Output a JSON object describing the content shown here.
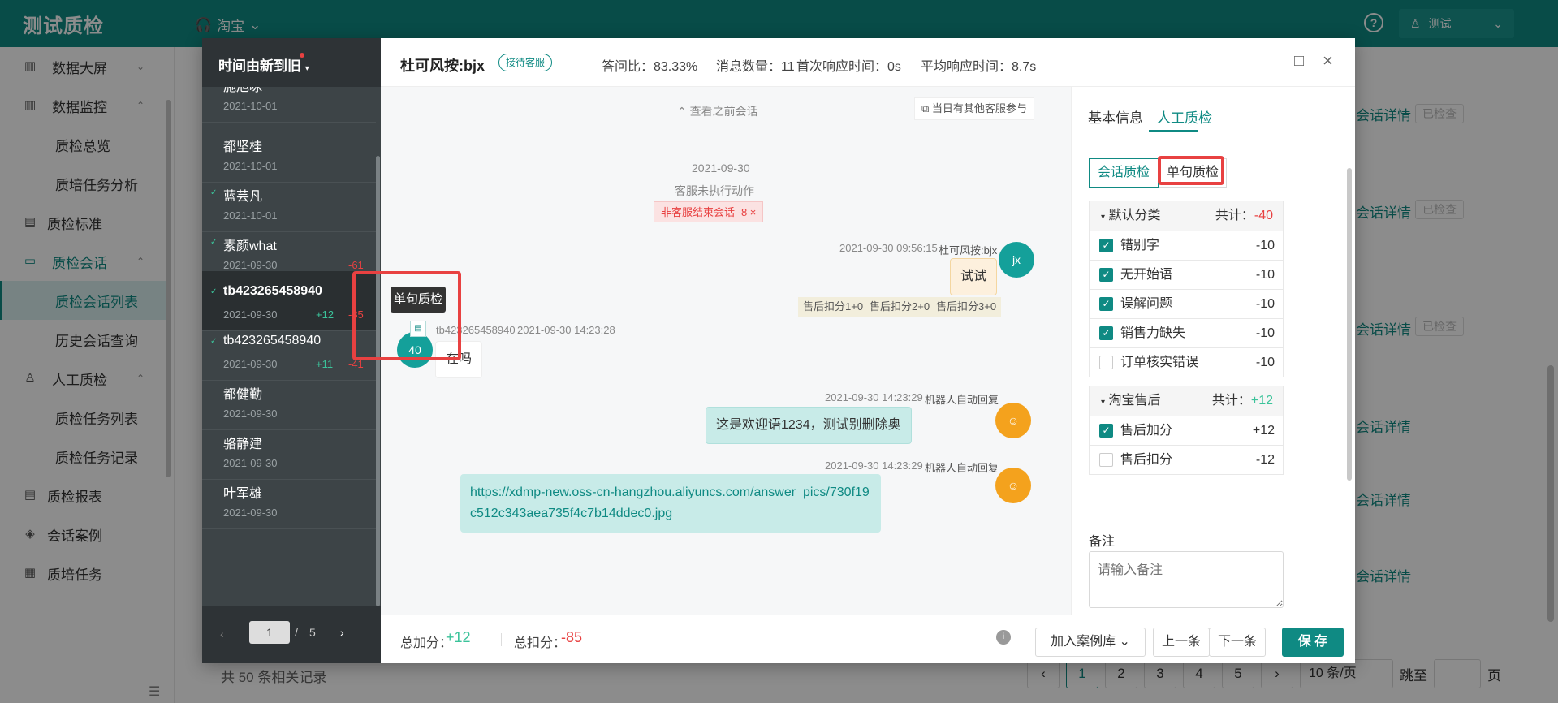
{
  "app": {
    "title": "测试质检",
    "shop": "淘宝",
    "user": "测试",
    "help": "?"
  },
  "sidebar": {
    "items": [
      {
        "label": "数据大屏",
        "icon": "bar-chart-icon",
        "glyph": "▥",
        "arrow": "⌄"
      },
      {
        "label": "数据监控",
        "icon": "monitor-icon",
        "glyph": "▥",
        "arrow": "⌃"
      },
      {
        "label": "质检总览"
      },
      {
        "label": "质培任务分析"
      },
      {
        "label": "质检标准",
        "icon": "document-icon",
        "glyph": "▤"
      },
      {
        "label": "质检会话",
        "icon": "chat-icon",
        "glyph": "▭",
        "arrow": "⌃"
      },
      {
        "label": "质检会话列表"
      },
      {
        "label": "历史会话查询"
      },
      {
        "label": "人工质检",
        "icon": "user-check-icon",
        "glyph": "♙",
        "arrow": "⌃"
      },
      {
        "label": "质检任务列表"
      },
      {
        "label": "质检任务记录"
      },
      {
        "label": "质检报表",
        "icon": "report-icon",
        "glyph": "▤"
      },
      {
        "label": "会话案例",
        "icon": "layers-icon",
        "glyph": "◈"
      },
      {
        "label": "质培任务",
        "icon": "task-icon",
        "glyph": "▦"
      }
    ],
    "collapse": "☰"
  },
  "background": {
    "detail_link": "会话详情",
    "checked_tag": "已检查",
    "total": "共 50 条相关记录",
    "pages": [
      "1",
      "2",
      "3",
      "4",
      "5"
    ],
    "page_size": "10 条/页",
    "jump_label": "跳至",
    "page_label": "页"
  },
  "modal": {
    "left": {
      "sort_label": "时间由新到旧",
      "items": [
        {
          "name": "施旭咏",
          "date": "2021-10-01"
        },
        {
          "name": "都坚桂",
          "date": "2021-10-01"
        },
        {
          "name": "蓝芸凡",
          "date": "2021-10-01",
          "check": "✓"
        },
        {
          "name": "素颜what",
          "date": "2021-09-30",
          "check": "✓",
          "minus": "-61"
        },
        {
          "name": "tb423265458940",
          "date": "2021-09-30",
          "check": "✓",
          "plus": "+12",
          "minus": "-85"
        },
        {
          "name": "tb423265458940",
          "date": "2021-09-30",
          "check": "✓",
          "plus": "+11",
          "minus": "-41"
        },
        {
          "name": "都健勤",
          "date": "2021-09-30"
        },
        {
          "name": "骆静建",
          "date": "2021-09-30"
        },
        {
          "name": "叶军雄",
          "date": "2021-09-30"
        }
      ],
      "pager": {
        "current": "1",
        "slash": "/",
        "total": "5",
        "prev": "‹",
        "next": "›"
      }
    },
    "header": {
      "title": "杜可风按:bjx",
      "status": "接待客服",
      "answer_ratio": "答问比：83.33%",
      "msg_count": "消息数量：11",
      "first_resp": "首次响应时间：0s",
      "avg_resp": "平均响应时间：8.7s",
      "max_icon": "□",
      "close_icon": "×"
    },
    "chat": {
      "view_prev": "⌃ 查看之前会话",
      "other_agents": "⧉ 当日有其他客服参与",
      "date": "2021-09-30",
      "agent_note": "客服未执行动作",
      "tag": "非客服结束会话 -8 ×",
      "msg1": {
        "time": "2021-09-30 09:56:15",
        "sender": "杜可风按:bjx",
        "text": "试试",
        "avatar": "jx"
      },
      "deductions": [
        "售后扣分1+0",
        "售后扣分2+0",
        "售后扣分3+0"
      ],
      "msg2": {
        "sender": "tb423265458940",
        "time": "2021-09-30 14:23:28",
        "text": "在吗",
        "avatar": "40"
      },
      "tooltip": "单句质检",
      "msg3": {
        "time": "2021-09-30 14:23:29",
        "sender": "机器人自动回复",
        "text": "这是欢迎语1234，测试别删除奥",
        "avatar": "☺"
      },
      "msg4": {
        "time": "2021-09-30 14:23:29",
        "sender": "机器人自动回复",
        "text": "https://xdmp-new.oss-cn-hangzhou.aliyuncs.com/answer_pics/730f19c512c343aea735f4c7b14ddec0.jpg",
        "avatar": "☺"
      }
    },
    "right": {
      "tabs": [
        "基本信息",
        "人工质检"
      ],
      "segments": [
        "会话质检",
        "单句质检"
      ],
      "default_cat": {
        "name": "默认分类",
        "total_label": "共计：",
        "total": "-40",
        "items": [
          {
            "name": "错别字",
            "score": "-10",
            "checked": true
          },
          {
            "name": "无开始语",
            "score": "-10",
            "checked": true
          },
          {
            "name": "误解问题",
            "score": "-10",
            "checked": true
          },
          {
            "name": "销售力缺失",
            "score": "-10",
            "checked": true
          },
          {
            "name": "订单核实错误",
            "score": "-10",
            "checked": false
          }
        ]
      },
      "taobao_cat": {
        "name": "淘宝售后",
        "total_label": "共计：",
        "total": "+12",
        "items": [
          {
            "name": "售后加分",
            "score": "+12",
            "checked": true
          },
          {
            "name": "售后扣分",
            "score": "-12",
            "checked": false
          }
        ]
      },
      "remark_label": "备注",
      "remark_placeholder": "请输入备注"
    },
    "footer": {
      "plus_label": "总加分：",
      "plus": "+12",
      "minus_label": "总扣分：",
      "minus": "-85",
      "add_case": "加入案例库 ⌄",
      "prev": "上一条",
      "next": "下一条",
      "save": "保 存"
    }
  },
  "colors": {
    "brand": "#0f8a83",
    "danger": "#e84141",
    "success": "#3bc39a"
  }
}
